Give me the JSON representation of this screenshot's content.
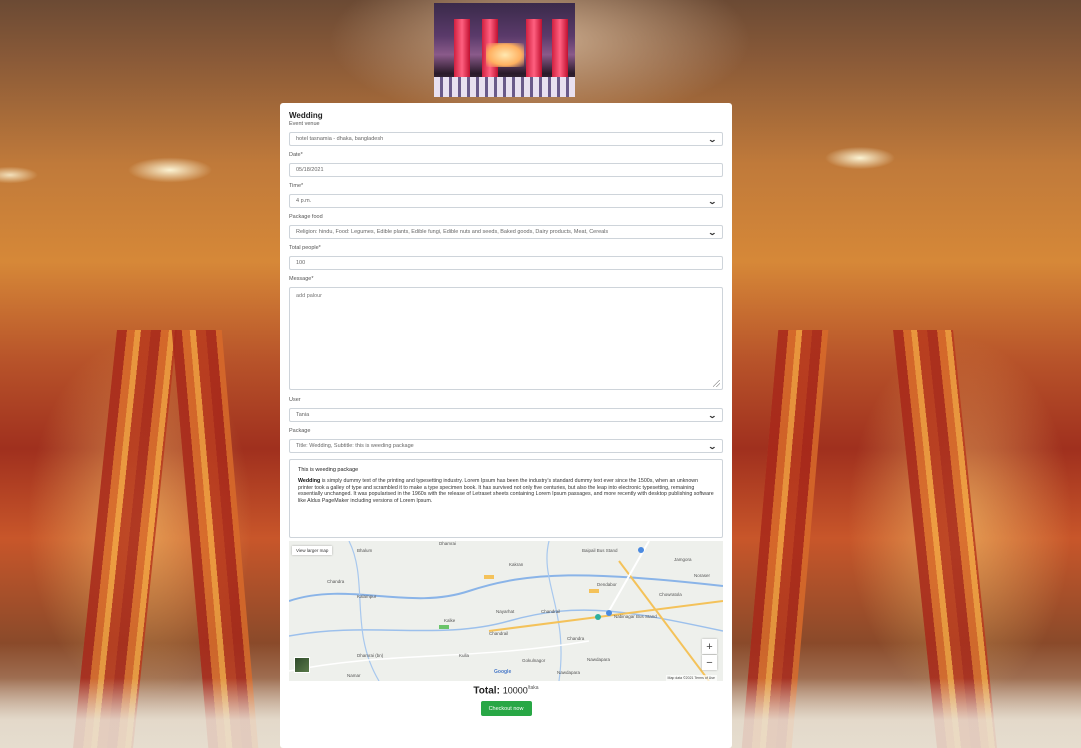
{
  "form": {
    "title": "Wedding",
    "venue": {
      "label": "Event venue",
      "value": "hotel tasnamia - dhaka, bangladesh"
    },
    "date": {
      "label": "Date*",
      "value": "05/18/2021"
    },
    "time": {
      "label": "Time*",
      "value": "4 p.m."
    },
    "food": {
      "label": "Package food",
      "value": "Religion: hindu, Food: Legumes, Edible plants, Edible fungi, Edible nuts and seeds, Baked goods, Dairy products, Meat, Cereals"
    },
    "people": {
      "label": "Total people*",
      "value": "100"
    },
    "message": {
      "label": "Message*",
      "value": "add palour"
    },
    "user": {
      "label": "User",
      "value": "Tania"
    },
    "package": {
      "label": "Package",
      "value": "Title: Wedding, Subtitle: this is weeding package"
    }
  },
  "description": {
    "heading": "This is weeding package",
    "bold": "Wedding",
    "body": " is simply dummy text of the printing and typesetting industry. Lorem Ipsum has been the industry's standard dummy text ever since the 1500s, when an unknown printer took a galley of type and scrambled it to make a type specimen book. It has survived not only five centuries, but also the leap into electronic typesetting, remaining essentially unchanged. It was popularised in the 1960s with the release of Letraset sheets containing Lorem Ipsum passages, and more recently with desktop publishing software like Aldus PageMaker including versions of Lorem Ipsum."
  },
  "map": {
    "view_larger": "View larger map",
    "places": [
      "Dhamrai",
      "Nayarhat",
      "Chandrail",
      "Kalampur",
      "Dendabor",
      "Baipail Bus Stand",
      "Nabinagar Bus Stand",
      "Kalke",
      "Jamgora",
      "Borotia",
      "Chandra",
      "Gazirchat",
      "Chowratola",
      "Gokulnagor",
      "Kulla",
      "Nawdapara",
      "Noraser",
      "Dhulivita",
      "Kakran",
      "Namar",
      "Bhalum",
      "Dhamrai (bn)",
      "Kalampur (bn)"
    ],
    "zoom_in": "+",
    "zoom_out": "−",
    "google": "Google",
    "footer": "Map data ©2021 Terms of Use"
  },
  "total": {
    "label": "Total:",
    "amount": "10000",
    "unit": "/taka"
  },
  "checkout": "Checkout now"
}
